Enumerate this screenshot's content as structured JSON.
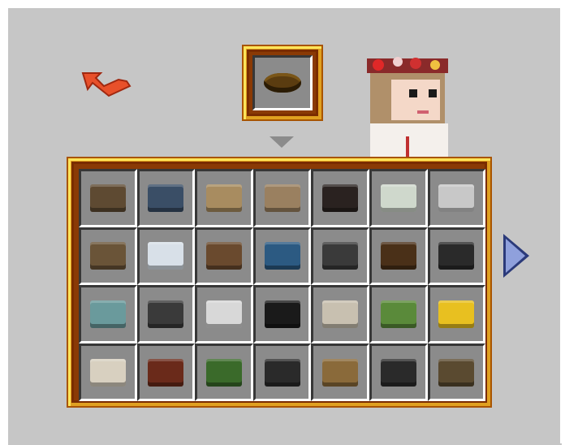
{
  "colors": {
    "background": "#c6c6c6",
    "slot": "#8b8b8b",
    "frame_gold": "#e0a020",
    "frame_dark": "#7a2c00",
    "back_arrow": "#e8502a",
    "next_arrow": "#8fa0dc"
  },
  "back_button": {
    "icon": "curved-back-arrow-icon"
  },
  "selected_item": {
    "icon": "wooden-bowl-icon",
    "color": "#5a3c10"
  },
  "dropdown": {
    "icon": "triangle-down-icon"
  },
  "player": {
    "icon": "player-skin-flower-crown"
  },
  "next_page": {
    "icon": "triangle-right-icon"
  },
  "items": [
    {
      "icon": "radio-icon",
      "color": "#5e4a32"
    },
    {
      "icon": "display-case-figure-icon",
      "color": "#3a4e66"
    },
    {
      "icon": "wicker-chest-icon",
      "color": "#a88c60"
    },
    {
      "icon": "picnic-basket-icon",
      "color": "#9a8060"
    },
    {
      "icon": "alarm-clock-icon",
      "color": "#2a2220"
    },
    {
      "icon": "plant-display-icon",
      "color": "#cfd8cc"
    },
    {
      "icon": "grater-icon",
      "color": "#c8c8c8"
    },
    {
      "icon": "display-case-icon",
      "color": "#6a5438"
    },
    {
      "icon": "fishbowl-icon",
      "color": "#d8e0e8"
    },
    {
      "icon": "teddy-bear-icon",
      "color": "#6a4a2e"
    },
    {
      "icon": "globe-icon",
      "color": "#2c5a82"
    },
    {
      "icon": "camera-icon",
      "color": "#3a3a3a"
    },
    {
      "icon": "gramophone-icon",
      "color": "#4a3018"
    },
    {
      "icon": "chalkboard-sign-icon",
      "color": "#2a2a2a"
    },
    {
      "icon": "record-player-icon",
      "color": "#6a9a9c"
    },
    {
      "icon": "laptop-dark-icon",
      "color": "#3a3a3a"
    },
    {
      "icon": "laptop-light-icon",
      "color": "#d8d8d8"
    },
    {
      "icon": "monitor-icon",
      "color": "#1a1a1a"
    },
    {
      "icon": "film-camera-icon",
      "color": "#c8c0b0"
    },
    {
      "icon": "potted-plant-chest-icon",
      "color": "#5a8a3a"
    },
    {
      "icon": "gold-bars-icon",
      "color": "#e8c020"
    },
    {
      "icon": "iron-bars-icon",
      "color": "#d8d0c0"
    },
    {
      "icon": "treasure-chest-icon",
      "color": "#6a2a1a"
    },
    {
      "icon": "picture-frames-icon",
      "color": "#3a6a2a"
    },
    {
      "icon": "photo-frames-icon",
      "color": "#2a2a2a"
    },
    {
      "icon": "scales-icon",
      "color": "#8a6a3a"
    },
    {
      "icon": "typewriter-icon",
      "color": "#2a2a2a"
    },
    {
      "icon": "television-icon",
      "color": "#5a4a30"
    }
  ]
}
